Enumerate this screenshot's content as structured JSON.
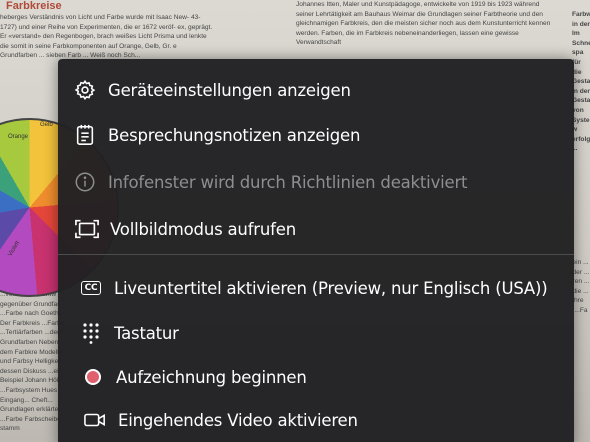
{
  "background_document": {
    "heading": "Farbkreise",
    "left_column": "heberges Verständnis von Licht und Farbe wurde mit Isaac New- 43-1727) und einer Reihe von Experimenten, die er 1672 veröf- ex, geprägt. Er «verstand» den Regenbogen, brach weißes Licht Prisma und lenkte die somit in seine Farbkomponenten auf Orange, Gelb, Gr. e Grundfarben ... sieben Farb ... Weiß noch Sch...",
    "mid_column": "Johannes Itten, Maler und Kunstpädagoge, entwickelte von 1919 bis 1923 während seiner Lehrtätigkeit am Bauhaus Weimar die Grundlagen seiner Farbtheorie und den gleichnamigen Farbkreis, den die meisten sicher noch aus dem Kunstunterricht kennen werden. Farben, die im Farbkreis nebeneinanderliegen, lassen eine gewisse Verwandtschaft",
    "right_column": "Farbwahl in der Im Schnell-spa für die Gestaltun in der Gestaltu von Systeme w erfolgen ...",
    "lower_left": "...von Newton entw gegenüber Grundfar ...Farbe nach Goethe Der Farbkreis ...Farbe ...Tertiärfarben ...den Grundfarben Neben dem Farbkre Modelle und Farbsy Helligkeit dessen Diskuss ...ein Beispiel Johann Hölz... ...Farbsystem Hues Eingang... Cheft... Grundlagen erklärte... ...Farbe Farbscheibe stamm",
    "lower_right": "...ein ... ...der ... ...ren ... ...die ... ...ihre ... ...Fa ...",
    "wheel_labels": [
      "Gelb",
      "Orange",
      "Violett"
    ]
  },
  "context_menu": {
    "items": [
      {
        "label": "Geräteeinstellungen anzeigen",
        "icon": "gear-icon",
        "enabled": true
      },
      {
        "label": "Besprechungsnotizen anzeigen",
        "icon": "notes-icon",
        "enabled": true
      },
      {
        "label": "Infofenster wird durch Richtlinien deaktiviert",
        "icon": "info-icon",
        "enabled": false
      },
      {
        "label": "Vollbildmodus aufrufen",
        "icon": "fullscreen-icon",
        "enabled": true
      },
      {
        "label": "Liveuntertitel aktivieren (Preview, nur Englisch (USA))",
        "icon": "closed-captions-icon",
        "enabled": true
      },
      {
        "label": "Tastatur",
        "icon": "keypad-icon",
        "enabled": true
      },
      {
        "label": "Aufzeichnung beginnen",
        "icon": "record-icon",
        "enabled": true
      },
      {
        "label": "Eingehendes Video aktivieren",
        "icon": "video-camera-icon",
        "enabled": true
      }
    ],
    "cc_badge": "CC",
    "colors": {
      "menu_background": "#212123",
      "text": "#ffffff",
      "disabled_text": "#8e8e90",
      "record_dot": "#e0606e"
    }
  }
}
